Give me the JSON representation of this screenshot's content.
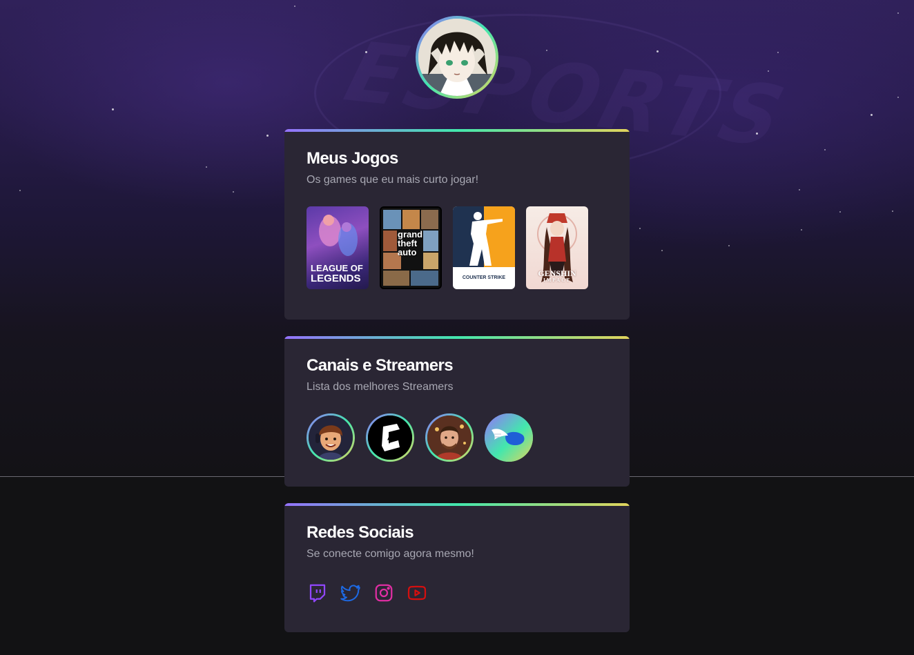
{
  "profile": {
    "avatar_icon": "profile-avatar"
  },
  "watermark": "ESPORTS",
  "sections": {
    "games": {
      "title": "Meus Jogos",
      "subtitle": "Os games que eu mais curto jogar!",
      "items": [
        {
          "name": "League of Legends",
          "logo_line1": "LEAGUE OF",
          "logo_line2": "LEGENDS"
        },
        {
          "name": "Grand Theft Auto V",
          "logo_line1": "grand",
          "logo_line2": "theft",
          "logo_line3": "auto"
        },
        {
          "name": "Counter-Strike",
          "logo_line1": "COUNTER STRIKE"
        },
        {
          "name": "Genshin Impact",
          "logo_line1": "GENSHIN",
          "logo_line2": "IMPACT"
        }
      ]
    },
    "streamers": {
      "title": "Canais e Streamers",
      "subtitle": "Lista dos melhores Streamers",
      "items": [
        "streamer-1",
        "streamer-2",
        "streamer-3",
        "streamer-4"
      ]
    },
    "social": {
      "title": "Redes Sociais",
      "subtitle": "Se conecte comigo agora mesmo!",
      "items": [
        {
          "icon": "twitch-icon",
          "color": "#9146ff"
        },
        {
          "icon": "twitter-icon",
          "color": "#1d6ae5"
        },
        {
          "icon": "instagram-icon",
          "color": "#e02ea3"
        },
        {
          "icon": "youtube-icon",
          "color": "#d50f0f"
        }
      ]
    }
  },
  "colors": {
    "gradient_start": "#9572fc",
    "gradient_mid": "#43e7ad",
    "gradient_end": "#e2d45c",
    "background": "#121214",
    "card": "#2a2634",
    "subtitle": "#a8a8b3"
  }
}
